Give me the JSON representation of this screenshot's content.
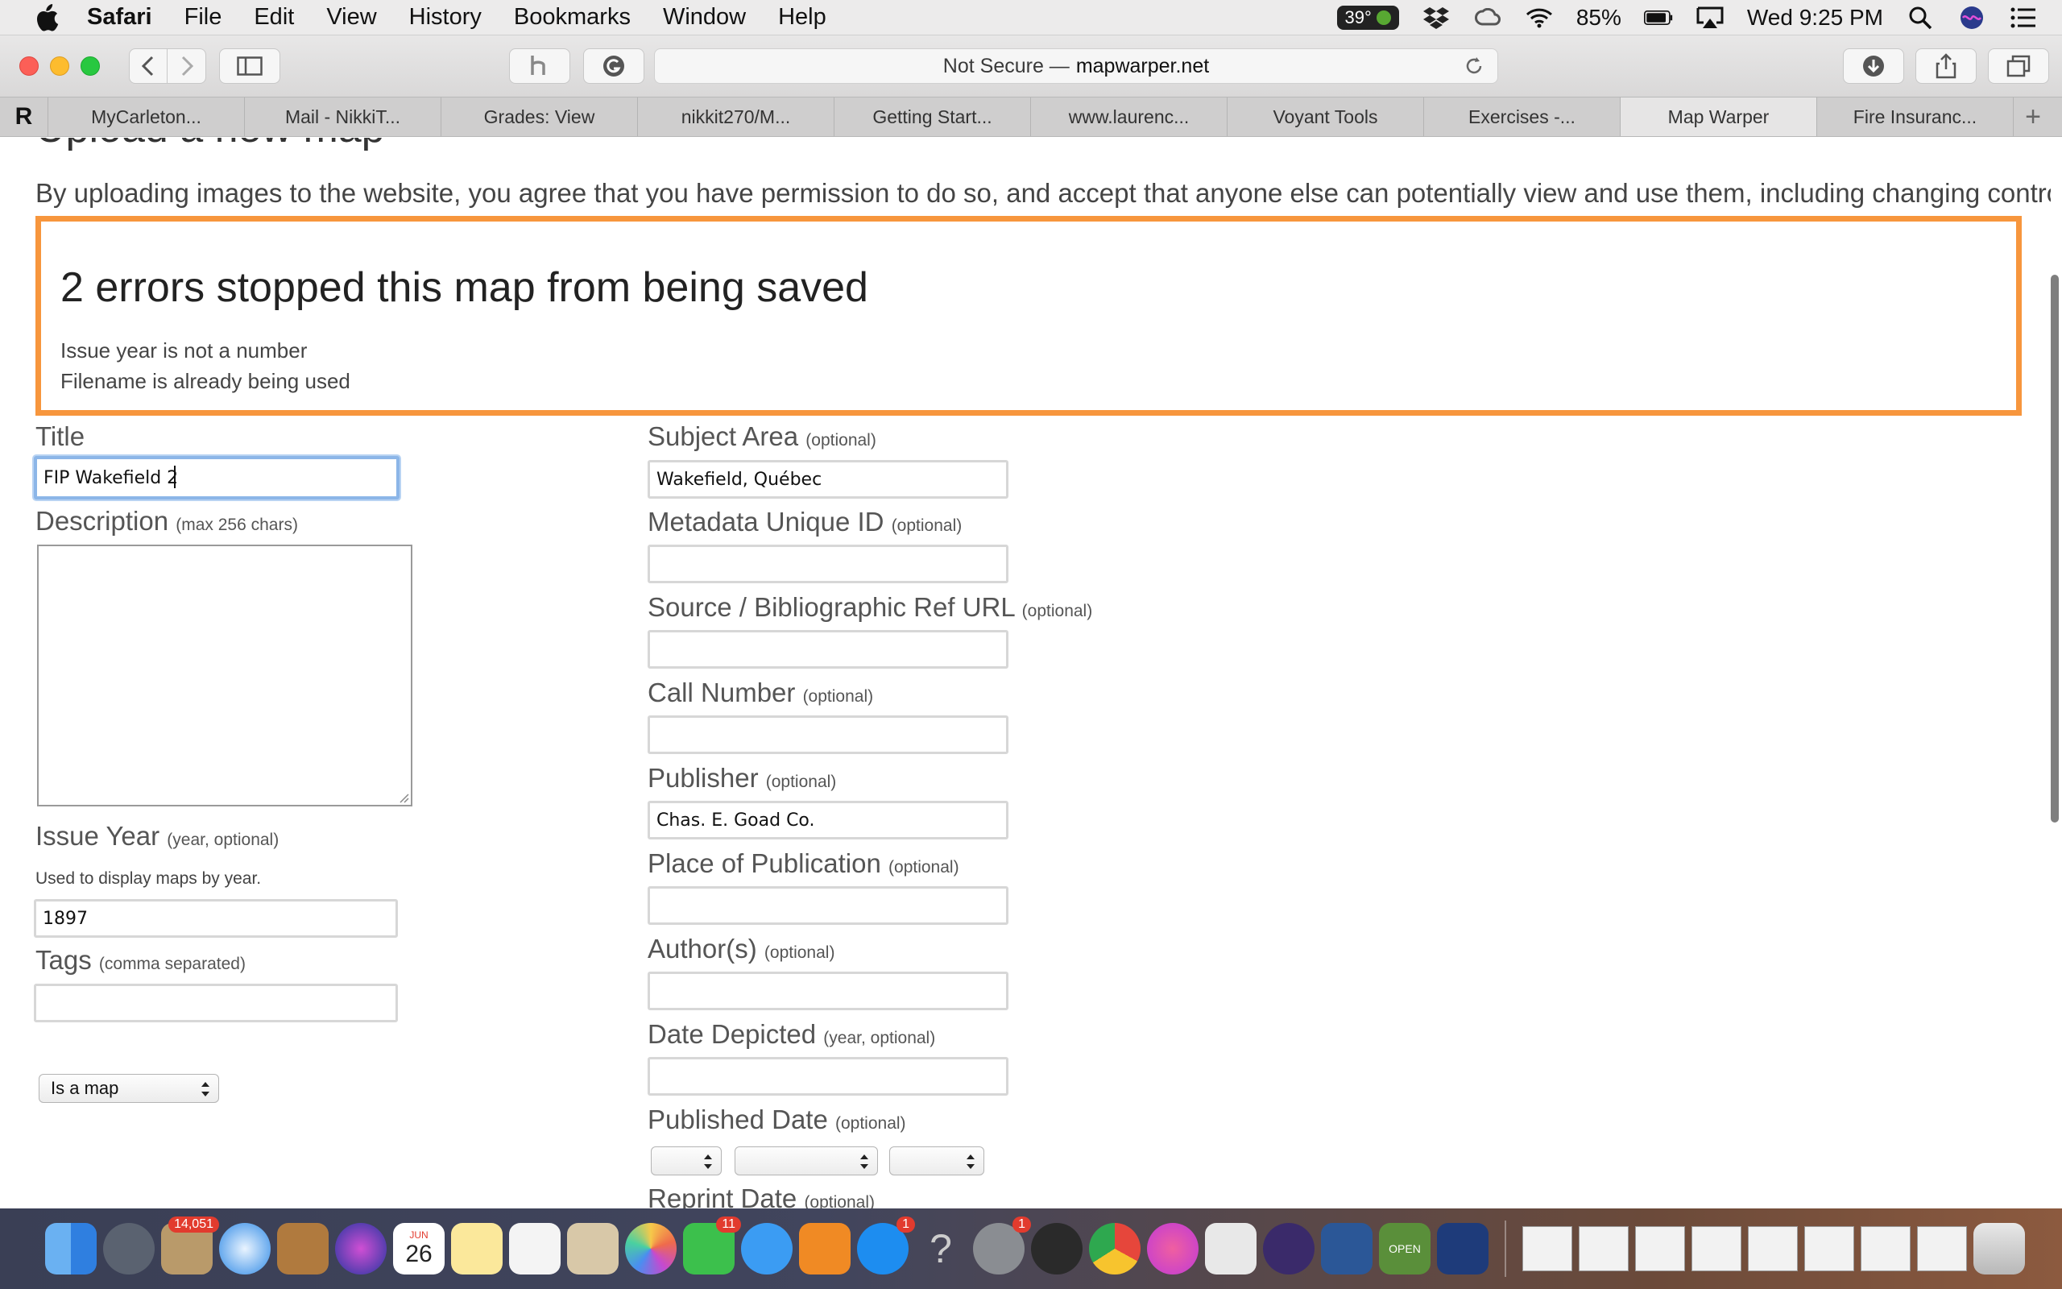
{
  "menubar": {
    "app_name": "Safari",
    "items": [
      "File",
      "Edit",
      "View",
      "History",
      "Bookmarks",
      "Window",
      "Help"
    ],
    "temperature": "39°",
    "battery": "85%",
    "clock": "Wed 9:25 PM"
  },
  "toolbar": {
    "address_prefix": "Not Secure —",
    "address_host": "mapwarper.net"
  },
  "tabs": {
    "first": "R",
    "items": [
      "MyCarleton...",
      "Mail - NikkiT...",
      "Grades: View",
      "nikkit270/M...",
      "Getting Start...",
      "www.laurenc...",
      "Voyant Tools",
      "Exercises -...",
      "Map Warper",
      "Fire Insuranc..."
    ],
    "active_index": 8,
    "new_tab": "+"
  },
  "page": {
    "heading": "Upload a new map",
    "agreement": "By uploading images to the website, you agree that you have permission to do so, and accept that anyone else can potentially view and use them, including changing control points.",
    "errors": {
      "title": "2 errors stopped this map from being saved",
      "items": [
        "Issue year is not a number",
        "Filename is already being used"
      ]
    },
    "left": {
      "title_label": "Title",
      "title_value": "FIP Wakefield 2",
      "description_label": "Description",
      "description_hint": "(max 256 chars)",
      "issue_year_label": "Issue Year",
      "issue_year_hint": "(year, optional)",
      "issue_year_note": "Used to display maps by year.",
      "issue_year_value": "1897",
      "tags_label": "Tags",
      "tags_hint": "(comma separated)",
      "type_select": "Is a map"
    },
    "right": {
      "subject_label": "Subject Area",
      "subject_value": "Wakefield, Québec",
      "metadata_label": "Metadata Unique ID",
      "source_label": "Source / Bibliographic Ref URL",
      "call_label": "Call Number",
      "publisher_label": "Publisher",
      "publisher_value": "Chas. E. Goad Co.",
      "place_label": "Place of Publication",
      "author_label": "Author(s)",
      "date_depicted_label": "Date Depicted",
      "date_depicted_hint": "(year, optional)",
      "published_date_label": "Published Date",
      "reprint_date_label": "Reprint Date",
      "optional": "(optional)"
    }
  },
  "dock": {
    "mail_badge": "14,051",
    "calendar_month": "JUN",
    "calendar_day": "26",
    "facetime_badge": "11",
    "appstore_badge": "1",
    "prefs_badge": "1",
    "open_sign": "OPEN"
  }
}
